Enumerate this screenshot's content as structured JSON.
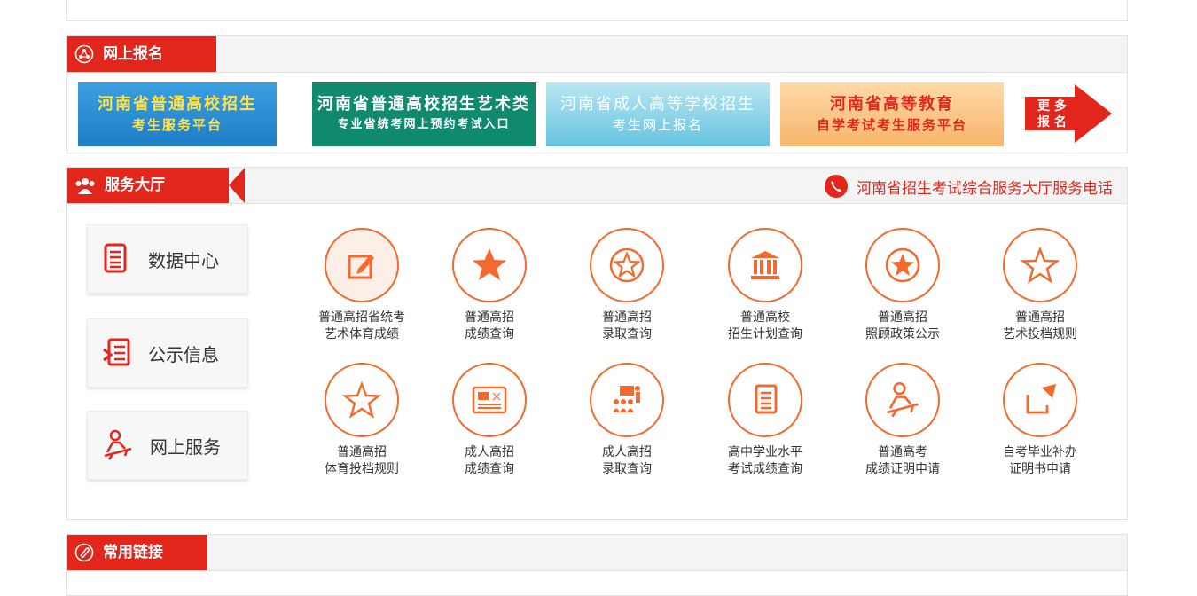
{
  "online_register": {
    "title": "网上报名",
    "banners": [
      {
        "line1": "河南省普通高校招生",
        "line2": "考生服务平台",
        "bg": "#2a8fd4"
      },
      {
        "line1": "河南省普通高校招生艺术类",
        "line2": "专业省统考网上预约考试入口",
        "bg": "#0f8a6f"
      },
      {
        "line1": "河南省成人高等学校招生",
        "line2": "考生网上报名",
        "bg": "#7fd0e6"
      },
      {
        "line1": "河南省高等教育",
        "line2": "自学考试考生服务平台",
        "bg": "#f3a64a"
      }
    ],
    "more": {
      "line1": "更 多",
      "line2": "报 名"
    }
  },
  "service_hall": {
    "title": "服务大厅",
    "hotline": "河南省招生考试综合服务大厅服务电话",
    "side": [
      {
        "label": "数据中心",
        "icon": "document-stack-icon"
      },
      {
        "label": "公示信息",
        "icon": "notice-icon"
      },
      {
        "label": "网上服务",
        "icon": "person-at-desk-icon"
      }
    ],
    "services": [
      {
        "l1": "普通高招省统考",
        "l2": "艺术体育成绩",
        "icon": "edit-icon"
      },
      {
        "l1": "普通高招",
        "l2": "成绩查询",
        "icon": "star-solid-icon"
      },
      {
        "l1": "普通高招",
        "l2": "录取查询",
        "icon": "star-badge-icon"
      },
      {
        "l1": "普通高校",
        "l2": "招生计划查询",
        "icon": "institution-icon"
      },
      {
        "l1": "普通高招",
        "l2": "照顾政策公示",
        "icon": "star-badge-icon"
      },
      {
        "l1": "普通高招",
        "l2": "艺术投档规则",
        "icon": "star-outline-icon"
      },
      {
        "l1": "普通高招",
        "l2": "体育投档规则",
        "icon": "star-outline-icon"
      },
      {
        "l1": "成人高招",
        "l2": "成绩查询",
        "icon": "id-card-icon"
      },
      {
        "l1": "成人高招",
        "l2": "录取查询",
        "icon": "presentation-icon"
      },
      {
        "l1": "高中学业水平",
        "l2": "考试成绩查询",
        "icon": "document-icon"
      },
      {
        "l1": "普通高考",
        "l2": "成绩证明申请",
        "icon": "person-at-desk-icon"
      },
      {
        "l1": "自考毕业补办",
        "l2": "证明书申请",
        "icon": "share-arrow-icon"
      }
    ]
  },
  "links": {
    "title": "常用链接"
  }
}
